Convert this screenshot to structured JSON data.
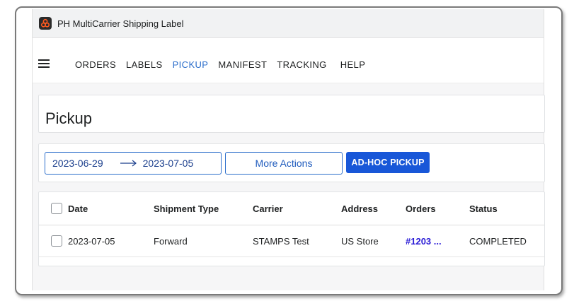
{
  "app": {
    "title": "PH MultiCarrier Shipping Label"
  },
  "nav": {
    "items": [
      {
        "label": "ORDERS",
        "active": false
      },
      {
        "label": "LABELS",
        "active": false
      },
      {
        "label": "PICKUP",
        "active": true
      },
      {
        "label": "MANIFEST",
        "active": false
      },
      {
        "label": "TRACKING",
        "active": false
      },
      {
        "label": "HELP",
        "active": false
      }
    ]
  },
  "page": {
    "title": "Pickup"
  },
  "filters": {
    "date_start": "2023-06-29",
    "date_end": "2023-07-05",
    "more_actions_label": "More Actions",
    "adhoc_label": "AD-HOC PICKUP"
  },
  "table": {
    "headers": [
      "Date",
      "Shipment Type",
      "Carrier",
      "Address",
      "Orders",
      "Status"
    ],
    "rows": [
      {
        "date": "2023-07-05",
        "shipment_type": "Forward",
        "carrier": "STAMPS Test",
        "address": "US Store",
        "orders": "#1203 ...",
        "status": "COMPLETED"
      }
    ]
  },
  "colors": {
    "accent": "#2c6ecb",
    "primary_button": "#1857d8",
    "link": "#2a1bd6"
  }
}
